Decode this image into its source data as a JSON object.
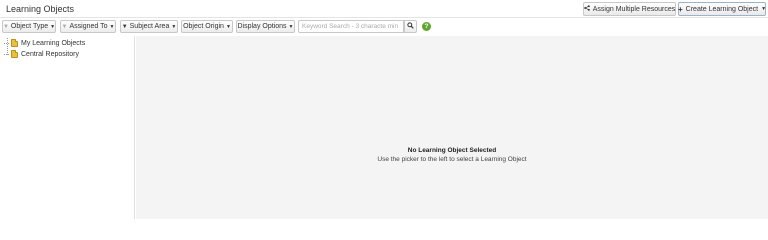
{
  "header": {
    "title": "Learning Objects",
    "assign_button": "Assign Multiple Resources",
    "create_button": "Create Learning Object"
  },
  "filters": {
    "object_type": "Object Type",
    "assigned_to": "Assigned To",
    "subject_area": "Subject Area",
    "object_origin": "Object Origin",
    "display_options": "Display Options"
  },
  "search": {
    "placeholder": "Keyword Search - 3 characte min",
    "value": ""
  },
  "tree": {
    "items": [
      {
        "label": "My Learning Objects",
        "icon": "folder-icon"
      },
      {
        "label": "Central Repository",
        "icon": "folder-icon"
      }
    ]
  },
  "detail": {
    "empty_title": "No Learning Object Selected",
    "empty_subtitle": "Use the picker to the left to select a Learning Object"
  },
  "colors": {
    "help_icon": "#5fa52e",
    "folder": "#e8c23c",
    "detail_background": "#f4f4f4"
  }
}
